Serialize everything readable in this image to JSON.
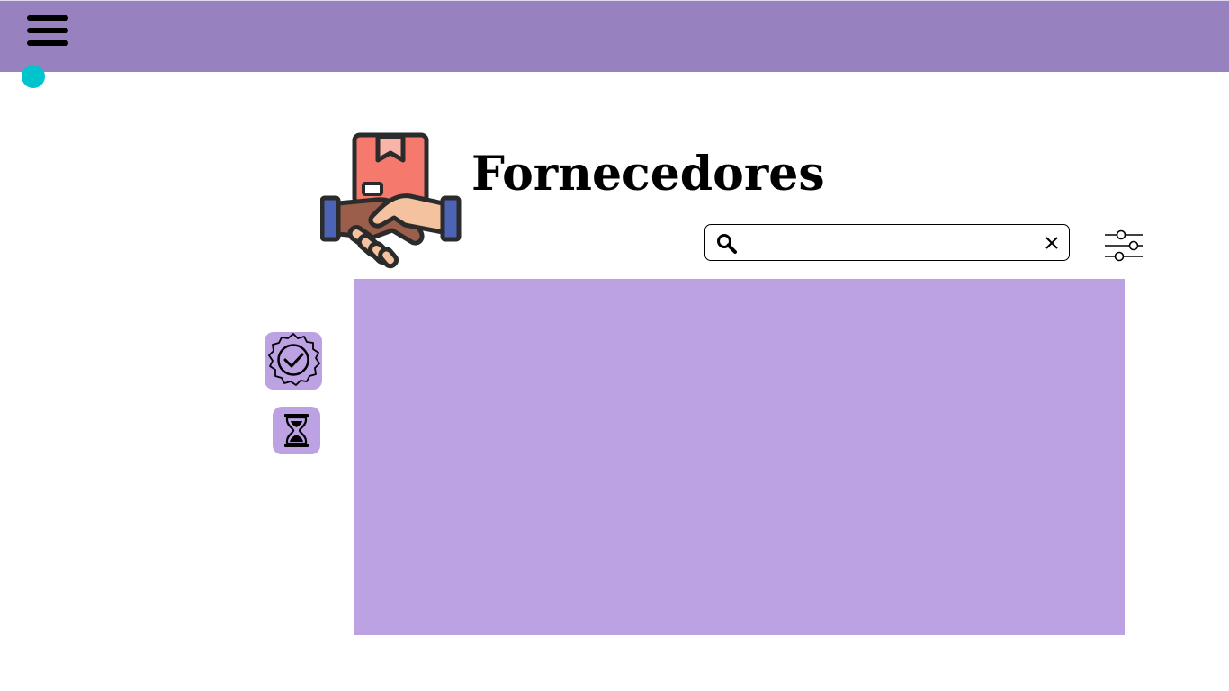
{
  "header": {
    "menu_icon": "hamburger-menu-icon"
  },
  "status_dot": {
    "icon": "status-dot"
  },
  "page": {
    "title": "Fornecedores",
    "logo_icon": "supplier-handshake-box-icon"
  },
  "search": {
    "value": "",
    "placeholder": "",
    "search_icon": "search-icon",
    "clear_icon": "close-icon"
  },
  "filter": {
    "icon": "sliders-filter-icon"
  },
  "side_buttons": [
    {
      "name": "approved",
      "icon": "verified-badge-icon"
    },
    {
      "name": "pending",
      "icon": "hourglass-icon"
    }
  ],
  "colors": {
    "header_bg": "#9881bf",
    "status_dot": "#00c4cc",
    "panel_bg": "#bca1e3",
    "button_bg": "#bca1e3"
  }
}
